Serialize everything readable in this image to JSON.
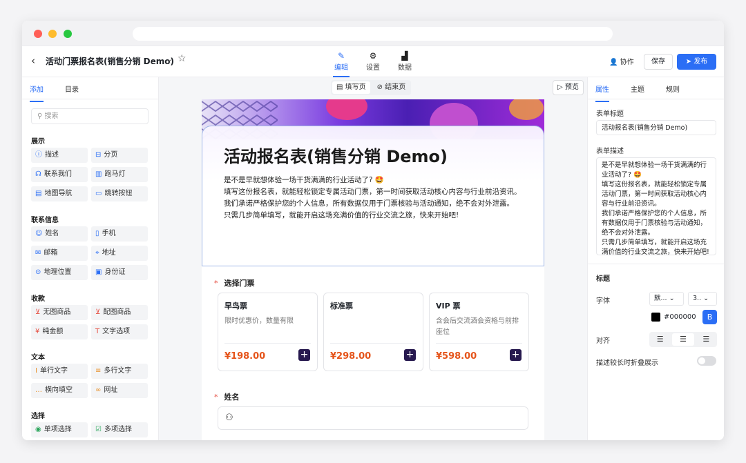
{
  "app": {
    "title": "活动门票报名表(销售分销 Demo)",
    "nav_tabs": [
      {
        "label": "编辑",
        "icon": "pen-icon"
      },
      {
        "label": "设置",
        "icon": "gear-icon"
      },
      {
        "label": "数据",
        "icon": "chart-icon"
      }
    ],
    "collab_label": "协作",
    "save_label": "保存",
    "publish_label": "发布"
  },
  "left_panel": {
    "tabs": [
      "添加",
      "目录"
    ],
    "search_placeholder": "搜索",
    "sections": [
      {
        "title": "展示",
        "items": [
          "描述",
          "分页",
          "联系我们",
          "跑马灯",
          "地图导航",
          "跳转按钮"
        ]
      },
      {
        "title": "联系信息",
        "items": [
          "姓名",
          "手机",
          "邮箱",
          "地址",
          "地理位置",
          "身份证"
        ]
      },
      {
        "title": "收款",
        "items": [
          "无图商品",
          "配图商品",
          "纯金额",
          "文字选项"
        ]
      },
      {
        "title": "文本",
        "items": [
          "单行文字",
          "多行文字",
          "横向填空",
          "网址"
        ]
      },
      {
        "title": "选择",
        "items": [
          "单项选择",
          "多项选择"
        ]
      }
    ]
  },
  "canvas": {
    "page_tabs": [
      "填写页",
      "结束页"
    ],
    "preview_label": "预览",
    "form_title": "活动报名表(销售分销 Demo)",
    "form_desc": [
      "是不是早就想体验一场干货满满的行业活动了? 🤩",
      "填写这份报名表，就能轻松锁定专属活动门票，第一时间获取活动核心内容与行业前沿资讯。",
      "我们承诺严格保护您的个人信息，所有数据仅用于门票核验与活动通知，绝不会对外泄露。",
      "只需几步简单填写，就能开启这场充满价值的行业交流之旅，快来开始吧!"
    ],
    "q1_label": "选择门票",
    "tickets": [
      {
        "name": "早鸟票",
        "desc": "限时优惠价，数量有限",
        "price": "¥198.00"
      },
      {
        "name": "标准票",
        "desc": "",
        "price": "¥298.00"
      },
      {
        "name": "VIP 票",
        "desc": "含会后交流酒会资格与前排座位",
        "price": "¥598.00"
      }
    ],
    "q2_label": "姓名"
  },
  "right_panel": {
    "tabs": [
      "属性",
      "主题",
      "规则"
    ],
    "form_title_label": "表单标题",
    "form_title_value": "活动报名表(销售分销 Demo)",
    "form_desc_label": "表单描述",
    "form_desc_value": "是不是早就想体验一场干货满满的行业活动了? 🤩\n填写这份报名表，就能轻松锁定专属活动门票，第一时间获取活动核心内容与行业前沿资讯。\n我们承诺严格保护您的个人信息，所有数据仅用于门票核验与活动通知，绝不会对外泄露。\n只需几步简单填写，就能开启这场充满价值的行业交流之旅，快来开始吧!",
    "heading_label": "标题",
    "font_label": "字体",
    "font_value": "默...",
    "size_value": "3..",
    "color_value": "#000000",
    "bold_label": "B",
    "align_label": "对齐",
    "collapse_label": "描述较长时折叠展示"
  },
  "colors": {
    "accent": "#2b6ef5",
    "price": "#e5541a",
    "required": "#e5483b"
  }
}
